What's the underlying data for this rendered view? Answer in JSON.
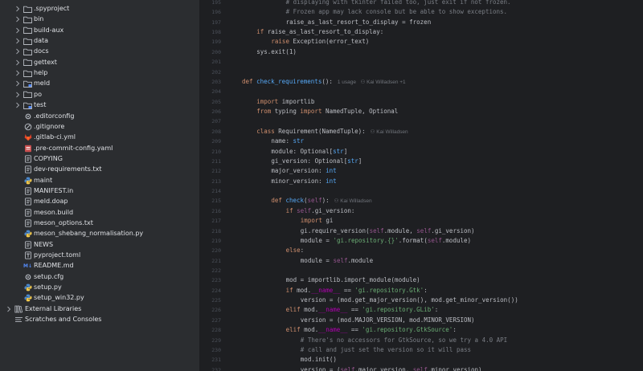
{
  "tree": [
    {
      "label": ".spyproject",
      "type": "folder",
      "chev": true
    },
    {
      "label": "bin",
      "type": "folder",
      "chev": true
    },
    {
      "label": "build-aux",
      "type": "folder",
      "chev": true
    },
    {
      "label": "data",
      "type": "folder",
      "chev": true
    },
    {
      "label": "docs",
      "type": "folder",
      "chev": true
    },
    {
      "label": "gettext",
      "type": "folder",
      "chev": true
    },
    {
      "label": "help",
      "type": "folder",
      "chev": true
    },
    {
      "label": "meld",
      "type": "folder-module",
      "chev": true
    },
    {
      "label": "po",
      "type": "folder",
      "chev": true
    },
    {
      "label": "test",
      "type": "folder-module",
      "chev": true
    },
    {
      "label": ".editorconfig",
      "type": "gear-file"
    },
    {
      "label": ".gitignore",
      "type": "ignore-file"
    },
    {
      "label": ".gitlab-ci.yml",
      "type": "gitlab-file"
    },
    {
      "label": ".pre-commit-config.yaml",
      "type": "yaml-file"
    },
    {
      "label": "COPYING",
      "type": "text-file"
    },
    {
      "label": "dev-requirements.txt",
      "type": "text-file"
    },
    {
      "label": "maint",
      "type": "python-file"
    },
    {
      "label": "MANIFEST.in",
      "type": "text-file"
    },
    {
      "label": "meld.doap",
      "type": "text-file"
    },
    {
      "label": "meson.build",
      "type": "text-file"
    },
    {
      "label": "meson_options.txt",
      "type": "text-file"
    },
    {
      "label": "meson_shebang_normalisation.py",
      "type": "python-file"
    },
    {
      "label": "NEWS",
      "type": "text-file"
    },
    {
      "label": "pyproject.toml",
      "type": "toml-file"
    },
    {
      "label": "README.md",
      "type": "markdown-file"
    },
    {
      "label": "setup.cfg",
      "type": "gear-file"
    },
    {
      "label": "setup.py",
      "type": "python-file"
    },
    {
      "label": "setup_win32.py",
      "type": "python-file"
    },
    {
      "label": "External Libraries",
      "type": "libraries",
      "chev": true,
      "root": true
    },
    {
      "label": "Scratches and Consoles",
      "type": "scratches",
      "root": true
    }
  ],
  "badge_md": "M↓",
  "editor": {
    "lines": [
      {
        "n": "195",
        "indent": 3,
        "tokens": [
          [
            "c",
            "# displaying with tkinter failed too, just exit if not frozen."
          ]
        ]
      },
      {
        "n": "196",
        "indent": 3,
        "tokens": [
          [
            "c",
            "# Frozen app may lack console but be able to show exceptions."
          ]
        ]
      },
      {
        "n": "197",
        "indent": 3,
        "tokens": [
          [
            "",
            "raise_as_last_resort_to_display = frozen"
          ]
        ]
      },
      {
        "n": "198",
        "indent": 1,
        "tokens": [
          [
            "k",
            "if "
          ],
          [
            "",
            "raise_as_last_resort_to_display:"
          ]
        ]
      },
      {
        "n": "199",
        "indent": 2,
        "tokens": [
          [
            "k",
            "raise "
          ],
          [
            "cls",
            "Exception"
          ],
          [
            "",
            "(error_text)"
          ]
        ]
      },
      {
        "n": "200",
        "indent": 1,
        "tokens": [
          [
            "",
            "sys.exit(1)"
          ]
        ]
      },
      {
        "n": "201",
        "indent": 0,
        "tokens": []
      },
      {
        "n": "202",
        "indent": 0,
        "tokens": []
      },
      {
        "n": "203",
        "indent": 0,
        "tokens": [
          [
            "k",
            "def "
          ],
          [
            "f",
            "check_requirements"
          ],
          [
            "",
            "():"
          ]
        ],
        "hint": "1 usage   ⚇ Kai Willadsen +1"
      },
      {
        "n": "204",
        "indent": 0,
        "tokens": []
      },
      {
        "n": "205",
        "indent": 1,
        "tokens": [
          [
            "k",
            "import "
          ],
          [
            "",
            "importlib"
          ]
        ]
      },
      {
        "n": "206",
        "indent": 1,
        "tokens": [
          [
            "k",
            "from "
          ],
          [
            "",
            "typing "
          ],
          [
            "k",
            "import "
          ],
          [
            "",
            "NamedTuple, Optional"
          ]
        ]
      },
      {
        "n": "207",
        "indent": 0,
        "tokens": []
      },
      {
        "n": "208",
        "indent": 1,
        "tokens": [
          [
            "k",
            "class "
          ],
          [
            "",
            "Requirement(NamedTuple):"
          ]
        ],
        "hint": "⚇ Kai Willadsen"
      },
      {
        "n": "209",
        "indent": 2,
        "tokens": [
          [
            "",
            "name: "
          ],
          [
            "f",
            "str"
          ]
        ]
      },
      {
        "n": "210",
        "indent": 2,
        "tokens": [
          [
            "",
            "module: Optional["
          ],
          [
            "f",
            "str"
          ],
          [
            "",
            "]"
          ]
        ]
      },
      {
        "n": "211",
        "indent": 2,
        "tokens": [
          [
            "",
            "gi_version: Optional["
          ],
          [
            "f",
            "str"
          ],
          [
            "",
            "]"
          ]
        ]
      },
      {
        "n": "212",
        "indent": 2,
        "tokens": [
          [
            "",
            "major_version: "
          ],
          [
            "f",
            "int"
          ]
        ]
      },
      {
        "n": "213",
        "indent": 2,
        "tokens": [
          [
            "",
            "minor_version: "
          ],
          [
            "f",
            "int"
          ]
        ]
      },
      {
        "n": "214",
        "indent": 0,
        "tokens": []
      },
      {
        "n": "215",
        "indent": 2,
        "tokens": [
          [
            "k",
            "def "
          ],
          [
            "f",
            "check"
          ],
          [
            "",
            "("
          ],
          [
            "sf",
            "self"
          ],
          [
            "",
            "):"
          ]
        ],
        "hint": "⚇ Kai Willadsen"
      },
      {
        "n": "216",
        "indent": 3,
        "tokens": [
          [
            "k",
            "if "
          ],
          [
            "sf",
            "self"
          ],
          [
            "",
            ".gi_version:"
          ]
        ]
      },
      {
        "n": "217",
        "indent": 4,
        "tokens": [
          [
            "k",
            "import "
          ],
          [
            "",
            "gi"
          ]
        ]
      },
      {
        "n": "218",
        "indent": 4,
        "tokens": [
          [
            "",
            "gi.require_version("
          ],
          [
            "sf",
            "self"
          ],
          [
            "",
            ".module, "
          ],
          [
            "sf",
            "self"
          ],
          [
            "",
            ".gi_version)"
          ]
        ]
      },
      {
        "n": "219",
        "indent": 4,
        "tokens": [
          [
            "",
            "module = "
          ],
          [
            "s",
            "'gi.repository.{}'"
          ],
          [
            "",
            ".format("
          ],
          [
            "sf",
            "self"
          ],
          [
            "",
            ".module)"
          ]
        ]
      },
      {
        "n": "220",
        "indent": 3,
        "tokens": [
          [
            "k",
            "else"
          ],
          [
            "",
            ":"
          ]
        ]
      },
      {
        "n": "221",
        "indent": 4,
        "tokens": [
          [
            "",
            "module = "
          ],
          [
            "sf",
            "self"
          ],
          [
            "",
            ".module"
          ]
        ]
      },
      {
        "n": "222",
        "indent": 0,
        "tokens": []
      },
      {
        "n": "223",
        "indent": 3,
        "tokens": [
          [
            "",
            "mod = importlib.import_module(module)"
          ]
        ]
      },
      {
        "n": "224",
        "indent": 3,
        "tokens": [
          [
            "k",
            "if "
          ],
          [
            "",
            "mod."
          ],
          [
            "sp",
            "__name__"
          ],
          [
            "",
            " == "
          ],
          [
            "s",
            "'gi.repository.Gtk'"
          ],
          [
            "",
            ":"
          ]
        ]
      },
      {
        "n": "225",
        "indent": 4,
        "tokens": [
          [
            "",
            "version = (mod.get_major_version(), mod.get_minor_version())"
          ]
        ]
      },
      {
        "n": "226",
        "indent": 3,
        "tokens": [
          [
            "k",
            "elif "
          ],
          [
            "",
            "mod."
          ],
          [
            "sp",
            "__name__"
          ],
          [
            "",
            " == "
          ],
          [
            "s",
            "'gi.repository.GLib'"
          ],
          [
            "",
            ":"
          ]
        ]
      },
      {
        "n": "227",
        "indent": 4,
        "tokens": [
          [
            "",
            "version = (mod.MAJOR_VERSION, mod.MINOR_VERSION)"
          ]
        ]
      },
      {
        "n": "228",
        "indent": 3,
        "tokens": [
          [
            "k",
            "elif "
          ],
          [
            "",
            "mod."
          ],
          [
            "sp",
            "__name__"
          ],
          [
            "",
            " == "
          ],
          [
            "s",
            "'gi.repository.GtkSource'"
          ],
          [
            "",
            ":"
          ]
        ]
      },
      {
        "n": "229",
        "indent": 4,
        "tokens": [
          [
            "c",
            "# There's no accessors for GtkSource, so we try a 4.0 API"
          ]
        ]
      },
      {
        "n": "230",
        "indent": 4,
        "tokens": [
          [
            "c",
            "# call and just set the version so it will pass"
          ]
        ]
      },
      {
        "n": "231",
        "indent": 4,
        "tokens": [
          [
            "",
            "mod.init()"
          ]
        ]
      },
      {
        "n": "232",
        "indent": 4,
        "tokens": [
          [
            "",
            "version = ("
          ],
          [
            "sf",
            "self"
          ],
          [
            "",
            ".major_version, "
          ],
          [
            "sf",
            "self"
          ],
          [
            "",
            ".minor_version)"
          ]
        ]
      }
    ]
  }
}
